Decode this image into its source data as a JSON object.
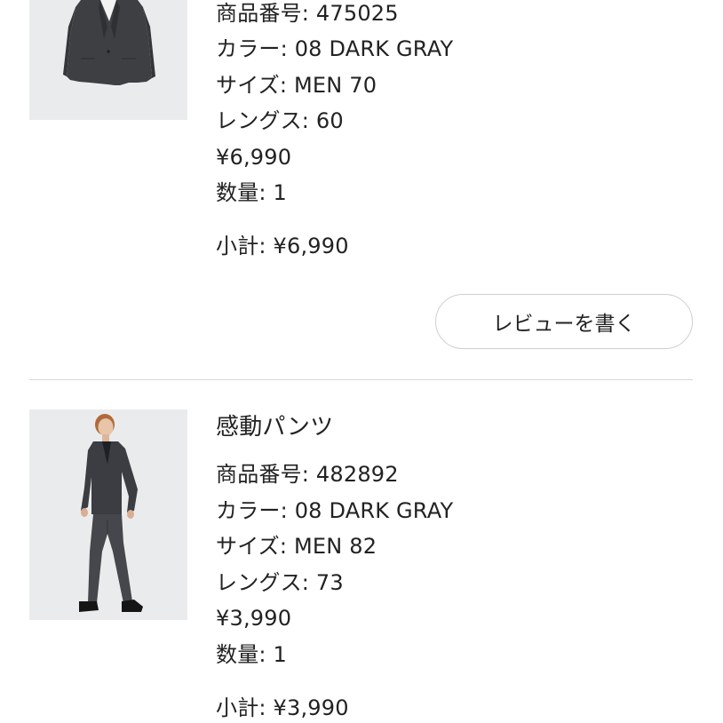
{
  "items": [
    {
      "product_number": "商品番号: 475025",
      "color": "カラー: 08 DARK GRAY",
      "size": "サイズ: MEN 70",
      "length": "レングス: 60",
      "price": "¥6,990",
      "quantity": "数量: 1",
      "subtotal": "小計: ¥6,990",
      "review_button": "レビューを書く"
    },
    {
      "name": "感動パンツ",
      "product_number": "商品番号: 482892",
      "color": "カラー: 08 DARK GRAY",
      "size": "サイズ: MEN 82",
      "length": "レングス: 73",
      "price": "¥3,990",
      "quantity": "数量: 1",
      "subtotal": "小計: ¥3,990"
    }
  ],
  "colors": {
    "text": "#222222",
    "image_background": "#eaebec",
    "divider": "#d8d8d8",
    "button_border": "#cfcfcf",
    "garment": "#3d3f43"
  },
  "icons": {
    "item_1_image": "jacket-photo",
    "item_2_image": "model-in-suit-photo"
  }
}
